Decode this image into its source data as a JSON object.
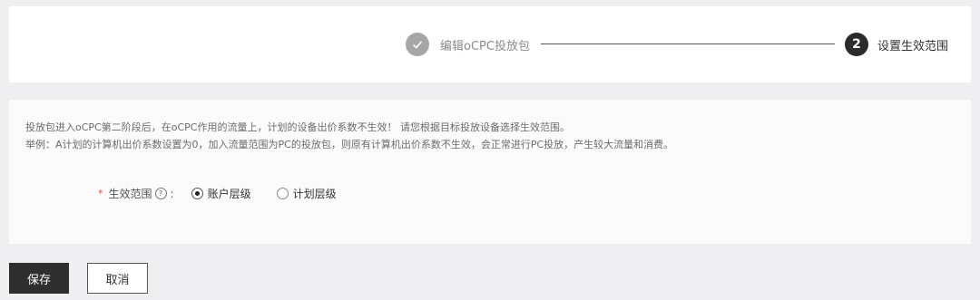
{
  "steps": [
    {
      "label": "编辑oCPC投放包",
      "state": "done",
      "icon": "check-icon"
    },
    {
      "label": "设置生效范围",
      "state": "active",
      "number": "2"
    }
  ],
  "notice": {
    "line1": "投放包进入oCPC第二阶段后，在oCPC作用的流量上，计划的设备出价系数不生效！ 请您根据目标投放设备选择生效范围。",
    "line2": "举例：A计划的计算机出价系数设置为0，加入流量范围为PC的投放包，则原有计算机出价系数不生效，会正常进行PC投放，产生较大流量和消费。"
  },
  "form": {
    "required_mark": "*",
    "scope_label": "生效范围",
    "help_glyph": "?",
    "colon": ":",
    "options": [
      {
        "label": "账户层级",
        "selected": true
      },
      {
        "label": "计划层级",
        "selected": false
      }
    ]
  },
  "actions": {
    "save_label": "保存",
    "cancel_label": "取消"
  },
  "colors": {
    "primary_button": "#2e2e2e",
    "active_step": "#2b2b2b",
    "done_step": "#a6a6a6",
    "required": "#e0453c"
  }
}
